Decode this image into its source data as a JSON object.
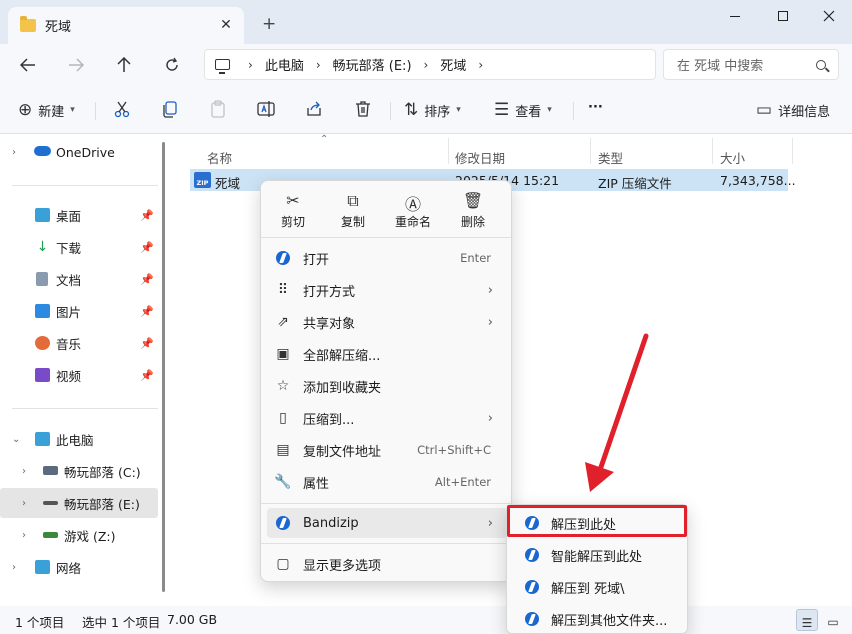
{
  "window": {
    "tab_title": "死域",
    "tab_close": "✕",
    "new_tab": "+"
  },
  "address": {
    "crumbs": [
      "此电脑",
      "畅玩部落 (E:)",
      "死域"
    ],
    "search_placeholder": "在 死域 中搜索"
  },
  "toolbar": {
    "new_label": "新建",
    "sort_label": "排序",
    "view_label": "查看",
    "more_label": "···",
    "details_label": "详细信息"
  },
  "sidebar": {
    "onedrive": "OneDrive",
    "quick": [
      {
        "label": "桌面"
      },
      {
        "label": "下载"
      },
      {
        "label": "文档"
      },
      {
        "label": "图片"
      },
      {
        "label": "音乐"
      },
      {
        "label": "视频"
      }
    ],
    "thispc": "此电脑",
    "drives": [
      {
        "label": "畅玩部落 (C:)"
      },
      {
        "label": "畅玩部落 (E:)"
      },
      {
        "label": "游戏 (Z:)"
      }
    ],
    "network": "网络"
  },
  "columns": {
    "name": "名称",
    "modified": "修改日期",
    "type": "类型",
    "size": "大小"
  },
  "file": {
    "icon_text": "ZIP",
    "name": "死域",
    "modified": "2025/5/14 15:21",
    "type": "ZIP 压缩文件",
    "size": "7,343,758..."
  },
  "context_menu": {
    "quick_actions": [
      {
        "label": "剪切",
        "icon": "scissors-icon"
      },
      {
        "label": "复制",
        "icon": "copy-icon"
      },
      {
        "label": "重命名",
        "icon": "rename-icon"
      },
      {
        "label": "删除",
        "icon": "trash-icon"
      }
    ],
    "items": [
      {
        "label": "打开",
        "shortcut": "Enter"
      },
      {
        "label": "打开方式"
      },
      {
        "label": "共享对象"
      },
      {
        "label": "全部解压缩..."
      },
      {
        "label": "添加到收藏夹"
      },
      {
        "label": "压缩到..."
      },
      {
        "label": "复制文件地址",
        "shortcut": "Ctrl+Shift+C"
      },
      {
        "label": "属性",
        "shortcut": "Alt+Enter"
      },
      {
        "label": "Bandizip"
      },
      {
        "label": "显示更多选项"
      }
    ]
  },
  "submenu": {
    "items": [
      {
        "label": "解压到此处"
      },
      {
        "label": "智能解压到此处"
      },
      {
        "label": "解压到 死域\\"
      },
      {
        "label": "解压到其他文件夹..."
      }
    ]
  },
  "status": {
    "count": "1 个项目",
    "selected": "选中 1 个项目",
    "size": "7.00 GB"
  },
  "colors": {
    "accent": "#1a67d2",
    "selection": "#cce3f6",
    "highlight_box": "#e0202a",
    "annotation_arrow": "#e0202a"
  }
}
